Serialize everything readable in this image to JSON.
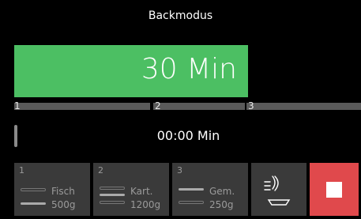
{
  "header": {
    "title": "Backmodus"
  },
  "timer": {
    "value": "30 Min"
  },
  "stages_bar": [
    {
      "label": "1"
    },
    {
      "label": "2"
    },
    {
      "label": "3"
    }
  ],
  "elapsed": {
    "value": "00:00 Min",
    "progress": 0
  },
  "stage_cards": [
    {
      "number": "1",
      "name": "Fisch",
      "weight": "500g"
    },
    {
      "number": "2",
      "name": "Kart.",
      "weight": "1200g"
    },
    {
      "number": "3",
      "name": "Gem.",
      "weight": "250g"
    }
  ],
  "colors": {
    "accent_green": "#4cbf63",
    "stop_red": "#e0494c",
    "card_bg": "#3a3a3a"
  },
  "icons": {
    "fan": "convection-fan-icon",
    "stop": "stop-square-icon"
  }
}
